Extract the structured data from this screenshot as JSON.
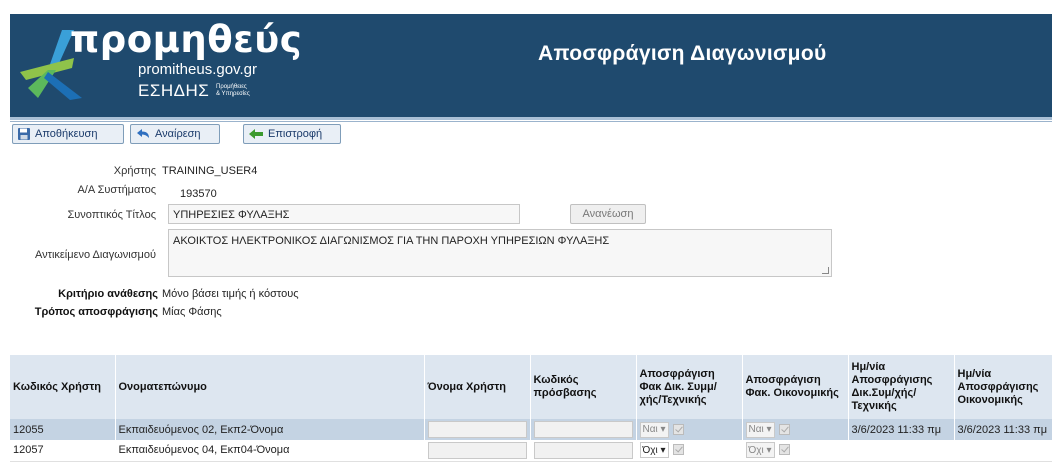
{
  "header": {
    "logo_word": "προμηθεύς",
    "logo_url": "promitheus.gov.gr",
    "logo_esidis": "ΕΣΗΔΗΣ",
    "logo_sub1": "Προμήθειες",
    "logo_sub2": "& Υπηρεσίες",
    "title": "Αποσφράγιση Διαγωνισμού",
    "bg_color": "#1f4a6e"
  },
  "toolbar": {
    "save_label": "Αποθήκευση",
    "undo_label": "Αναίρεση",
    "back_label": "Επιστροφή"
  },
  "form": {
    "user_label": "Χρήστης",
    "user_value": "TRAINING_USER4",
    "sysid_label": "Α/Α Συστήματος",
    "sysid_value": "193570",
    "short_title_label": "Συνοπτικός Τίτλος",
    "short_title_value": "ΥΠΗΡΕΣΙΕΣ ΦΥΛΑΞΗΣ",
    "refresh_label": "Ανανέωση",
    "subject_label": "Αντικείμενο Διαγωνισμού",
    "subject_value": "ΑΚΟΙΚΤΟΣ ΗΛΕΚΤΡΟΝΙΚΟΣ ΔΙΑΓΩΝΙΣΜΟΣ ΓΙΑ ΤΗΝ ΠΑΡΟΧΗ ΥΠΗΡΕΣΙΩΝ ΦΥΛΑΞΗΣ",
    "criterion_label": "Κριτήριο ανάθεσης",
    "criterion_value": "Μόνο βάσει τιμής ή κόστους",
    "mode_label": "Τρόπος αποσφράγισης",
    "mode_value": "Μίας Φάσης"
  },
  "table": {
    "headers": [
      "Κωδικός Χρήστη",
      "Ονοματεπώνυμο",
      "Όνομα Χρήστη",
      "Κωδικός πρόσβασης",
      "Αποσφράγιση Φακ Δικ. Συμμ/χής/Τεχνικής",
      "Αποσφράγιση Φακ. Οικονομικής",
      "Ημ/νία Αποσφράγισης Δικ.Συμ/χής/ Τεχνικής",
      "Ημ/νία Αποσφράγισης Οικονομικής"
    ],
    "rows": [
      {
        "code": "12055",
        "name": "Εκπαιδευόμενος 02, Εκπ2-Όνομα",
        "tech_select": "Ναι",
        "fin_select": "Ναι",
        "tech_date": "3/6/2023 11:33 πμ",
        "fin_date": "3/6/2023 11:33 πμ"
      },
      {
        "code": "12057",
        "name": "Εκπαιδευόμενος 04, Εκπ04-Όνομα",
        "tech_select": "Όχι",
        "fin_select": "Όχι",
        "tech_date": "",
        "fin_date": ""
      }
    ]
  }
}
